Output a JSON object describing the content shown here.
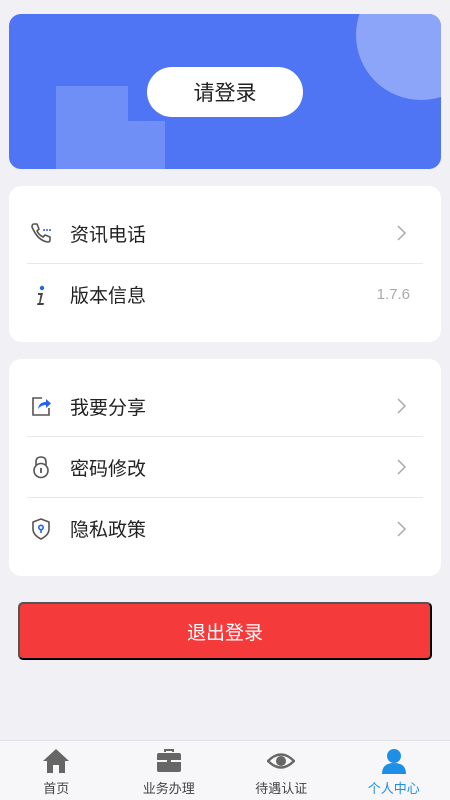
{
  "header": {
    "login_label": "请登录"
  },
  "info_card": {
    "items": [
      {
        "label": "资讯电话",
        "icon": "phone-icon"
      },
      {
        "label": "版本信息",
        "icon": "info-icon",
        "value": "1.7.6"
      }
    ]
  },
  "settings_card": {
    "items": [
      {
        "label": "我要分享",
        "icon": "share-icon"
      },
      {
        "label": "密码修改",
        "icon": "lock-icon"
      },
      {
        "label": "隐私政策",
        "icon": "shield-icon"
      }
    ]
  },
  "logout_label": "退出登录",
  "tabbar": {
    "tabs": [
      {
        "label": "首页",
        "icon": "home-icon"
      },
      {
        "label": "业务办理",
        "icon": "briefcase-icon"
      },
      {
        "label": "待遇认证",
        "icon": "eye-icon"
      },
      {
        "label": "个人中心",
        "icon": "person-icon",
        "active": true
      }
    ]
  },
  "colors": {
    "banner": "#4f75f5",
    "logout": "#f53a3c",
    "active_tab": "#1e8fe6"
  }
}
